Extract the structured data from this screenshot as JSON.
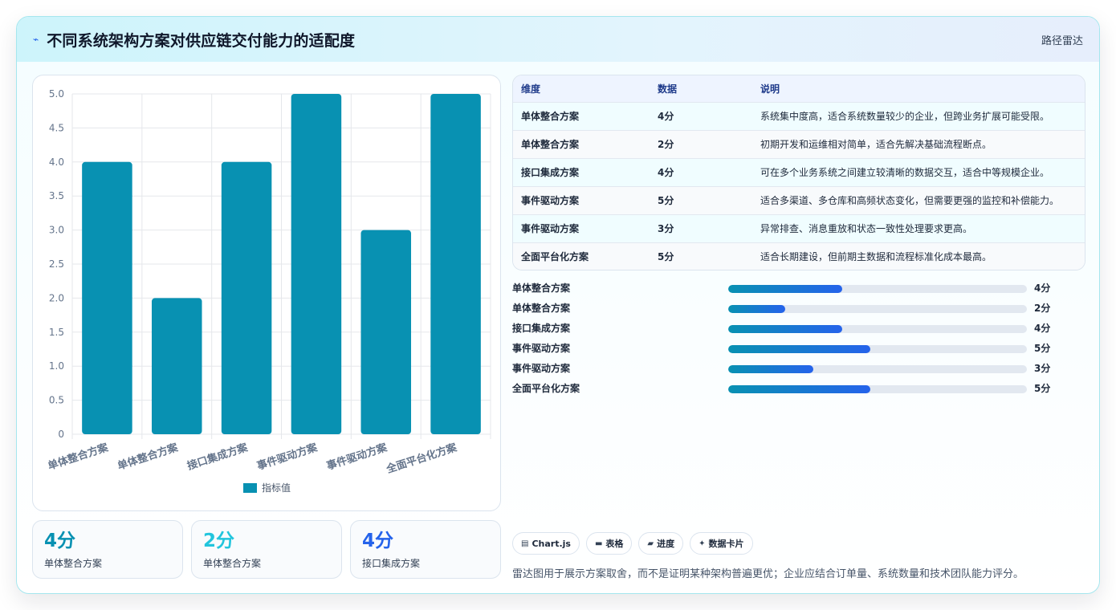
{
  "header": {
    "icon": "wave-icon",
    "title": "不同系统架构方案对供应链交付能力的适配度",
    "badge": "路径雷达"
  },
  "chart_data": {
    "type": "bar",
    "categories": [
      "单体整合方案",
      "单体整合方案",
      "接口集成方案",
      "事件驱动方案",
      "事件驱动方案",
      "全面平台化方案"
    ],
    "series": [
      {
        "name": "指标值",
        "values": [
          4,
          2,
          4,
          5,
          3,
          5
        ]
      }
    ],
    "ylim": [
      0,
      5
    ],
    "yticks": [
      "0",
      "0.5",
      "1.0",
      "1.5",
      "2.0",
      "2.5",
      "3.0",
      "3.5",
      "4.0",
      "4.5",
      "5.0"
    ],
    "grid": true,
    "legend": "bottom",
    "color": "#0891b2"
  },
  "stats": [
    {
      "value": "4分",
      "label": "单体整合方案",
      "color": "#0891b2"
    },
    {
      "value": "2分",
      "label": "单体整合方案",
      "color": "#22c5dd"
    },
    {
      "value": "4分",
      "label": "接口集成方案",
      "color": "#2563eb"
    }
  ],
  "table": {
    "headers": [
      "维度",
      "数据",
      "说明"
    ],
    "rows": [
      {
        "dim": "单体整合方案",
        "value": "4分",
        "desc": "系统集中度高，适合系统数量较少的企业，但跨业务扩展可能受限。"
      },
      {
        "dim": "单体整合方案",
        "value": "2分",
        "desc": "初期开发和运维相对简单，适合先解决基础流程断点。"
      },
      {
        "dim": "接口集成方案",
        "value": "4分",
        "desc": "可在多个业务系统之间建立较清晰的数据交互，适合中等规模企业。"
      },
      {
        "dim": "事件驱动方案",
        "value": "5分",
        "desc": "适合多渠道、多仓库和高频状态变化，但需要更强的监控和补偿能力。"
      },
      {
        "dim": "事件驱动方案",
        "value": "3分",
        "desc": "异常排查、消息重放和状态一致性处理要求更高。"
      },
      {
        "dim": "全面平台化方案",
        "value": "5分",
        "desc": "适合长期建设，但前期主数据和流程标准化成本最高。"
      }
    ]
  },
  "progress": [
    {
      "label": "单体整合方案",
      "value": 4,
      "text": "4分"
    },
    {
      "label": "单体整合方案",
      "value": 2,
      "text": "2分"
    },
    {
      "label": "接口集成方案",
      "value": 4,
      "text": "4分"
    },
    {
      "label": "事件驱动方案",
      "value": 5,
      "text": "5分"
    },
    {
      "label": "事件驱动方案",
      "value": 3,
      "text": "3分"
    },
    {
      "label": "全面平台化方案",
      "value": 5,
      "text": "5分"
    }
  ],
  "progress_scale_max": 10.5,
  "chips": [
    {
      "icon": "chart-icon",
      "glyph": "▤",
      "label": "Chart.js"
    },
    {
      "icon": "table-icon",
      "glyph": "▬",
      "label": "表格"
    },
    {
      "icon": "progress-icon",
      "glyph": "▰",
      "label": "进度"
    },
    {
      "icon": "sparkle-icon",
      "glyph": "✦",
      "label": "数据卡片"
    }
  ],
  "note": "雷达图用于展示方案取舍，而不是证明某种架构普遍更优；企业应结合订单量、系统数量和技术团队能力评分。"
}
